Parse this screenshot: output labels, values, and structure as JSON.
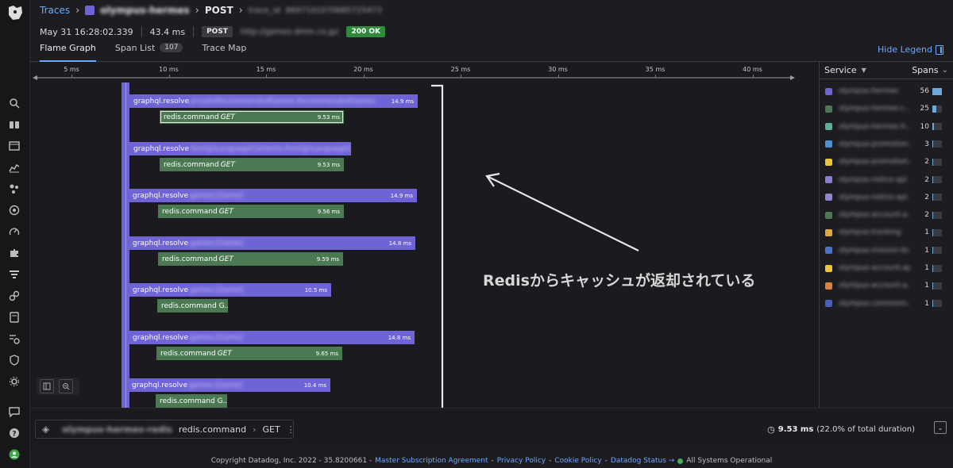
{
  "breadcrumb": {
    "traces": "Traces",
    "service": "olympus-hermes",
    "method": "POST",
    "trace_id_label": "trace_id",
    "trace_id": "8697101070685725473"
  },
  "meta": {
    "timestamp": "May 31 16:28:02.339",
    "duration": "43.4 ms",
    "method": "POST",
    "url": "http://games.dmm.co.jp/",
    "status": "200 OK"
  },
  "tabs": [
    {
      "label": "Flame Graph",
      "active": true
    },
    {
      "label": "Span List",
      "count": "107"
    },
    {
      "label": "Trace Map"
    }
  ],
  "hide_legend": "Hide Legend",
  "axis": {
    "ticks": [
      "5 ms",
      "10 ms",
      "15 ms",
      "20 ms",
      "25 ms",
      "30 ms",
      "35 ms",
      "40 ms"
    ]
  },
  "spans": [
    {
      "name": "graphql.resolve",
      "resource": "privateRecommendedGames.RecommendedGames",
      "duration": "14.9 ms"
    },
    {
      "name": "redis.command",
      "resource": "GET",
      "duration": "9.53 ms",
      "selected": true
    },
    {
      "name": "graphql.resolve",
      "resource": "foreignLanguageContents.ForeignLanguageConte...",
      "duration": ""
    },
    {
      "name": "redis.command",
      "resource": "GET",
      "duration": "9.53 ms"
    },
    {
      "name": "graphql.resolve",
      "resource": "games.[Game]",
      "duration": "14.9 ms"
    },
    {
      "name": "redis.command",
      "resource": "GET",
      "duration": "9.56 ms"
    },
    {
      "name": "graphql.resolve",
      "resource": "games.[Game]",
      "duration": "14.8 ms"
    },
    {
      "name": "redis.command",
      "resource": "GET",
      "duration": "9.59 ms"
    },
    {
      "name": "graphql.resolve",
      "resource": "games.[Game]",
      "duration": "10.5 ms"
    },
    {
      "name": "redis.command G...",
      "resource": "",
      "duration": ""
    },
    {
      "name": "graphql.resolve",
      "resource": "games.[Game]",
      "duration": "14.8 ms"
    },
    {
      "name": "redis.command",
      "resource": "GET",
      "duration": "9.65 ms"
    },
    {
      "name": "graphql.resolve",
      "resource": "games.[Game]",
      "duration": "10.4 ms"
    },
    {
      "name": "redis.command G...",
      "resource": "",
      "duration": ""
    }
  ],
  "annotation": "Redisからキャッシュが返却されている",
  "legend": {
    "service_header": "Service",
    "spans_header": "Spans",
    "rows": [
      {
        "name": "olympus-hermes",
        "count": "56",
        "color": "#6f64d6",
        "share": 0.52
      },
      {
        "name": "olympus-hermes-r...",
        "count": "25",
        "color": "#4b7a52",
        "share": 0.23
      },
      {
        "name": "olympus-hermes-h...",
        "count": "10",
        "color": "#5fae9a",
        "share": 0.09
      },
      {
        "name": "olympus-promotion...",
        "count": "3",
        "color": "#4d8fd6",
        "share": 0.03
      },
      {
        "name": "olympus-promotion...",
        "count": "2",
        "color": "#e8c53a",
        "share": 0.02
      },
      {
        "name": "olympus-notice-api",
        "count": "2",
        "color": "#8a7fd0",
        "share": 0.02
      },
      {
        "name": "olympus-notice-api...",
        "count": "2",
        "color": "#9584d2",
        "share": 0.02
      },
      {
        "name": "olympus-account-a...",
        "count": "2",
        "color": "#4b7a52",
        "share": 0.02
      },
      {
        "name": "olympus-tracking",
        "count": "1",
        "color": "#e0a93a",
        "share": 0.01
      },
      {
        "name": "olympus-mission-br...",
        "count": "1",
        "color": "#4a74c9",
        "share": 0.01
      },
      {
        "name": "olympus-account-api",
        "count": "1",
        "color": "#e8c53a",
        "share": 0.01
      },
      {
        "name": "olympus-account-a...",
        "count": "1",
        "color": "#d9823f",
        "share": 0.01
      },
      {
        "name": "olympus-commonn...",
        "count": "1",
        "color": "#4660c0",
        "share": 0.01
      }
    ]
  },
  "detail": {
    "service": "olympus-hermes-redis",
    "operation": "redis.command",
    "resource": "GET",
    "duration": "9.53 ms",
    "duration_share": "(22.0% of total duration)"
  },
  "footer": {
    "copyright": "Copyright Datadog, Inc. 2022 - 35.8200661 -",
    "links": [
      "Master Subscription Agreement",
      "Privacy Policy",
      "Cookie Policy",
      "Datadog Status →"
    ],
    "status": "All Systems Operational"
  }
}
